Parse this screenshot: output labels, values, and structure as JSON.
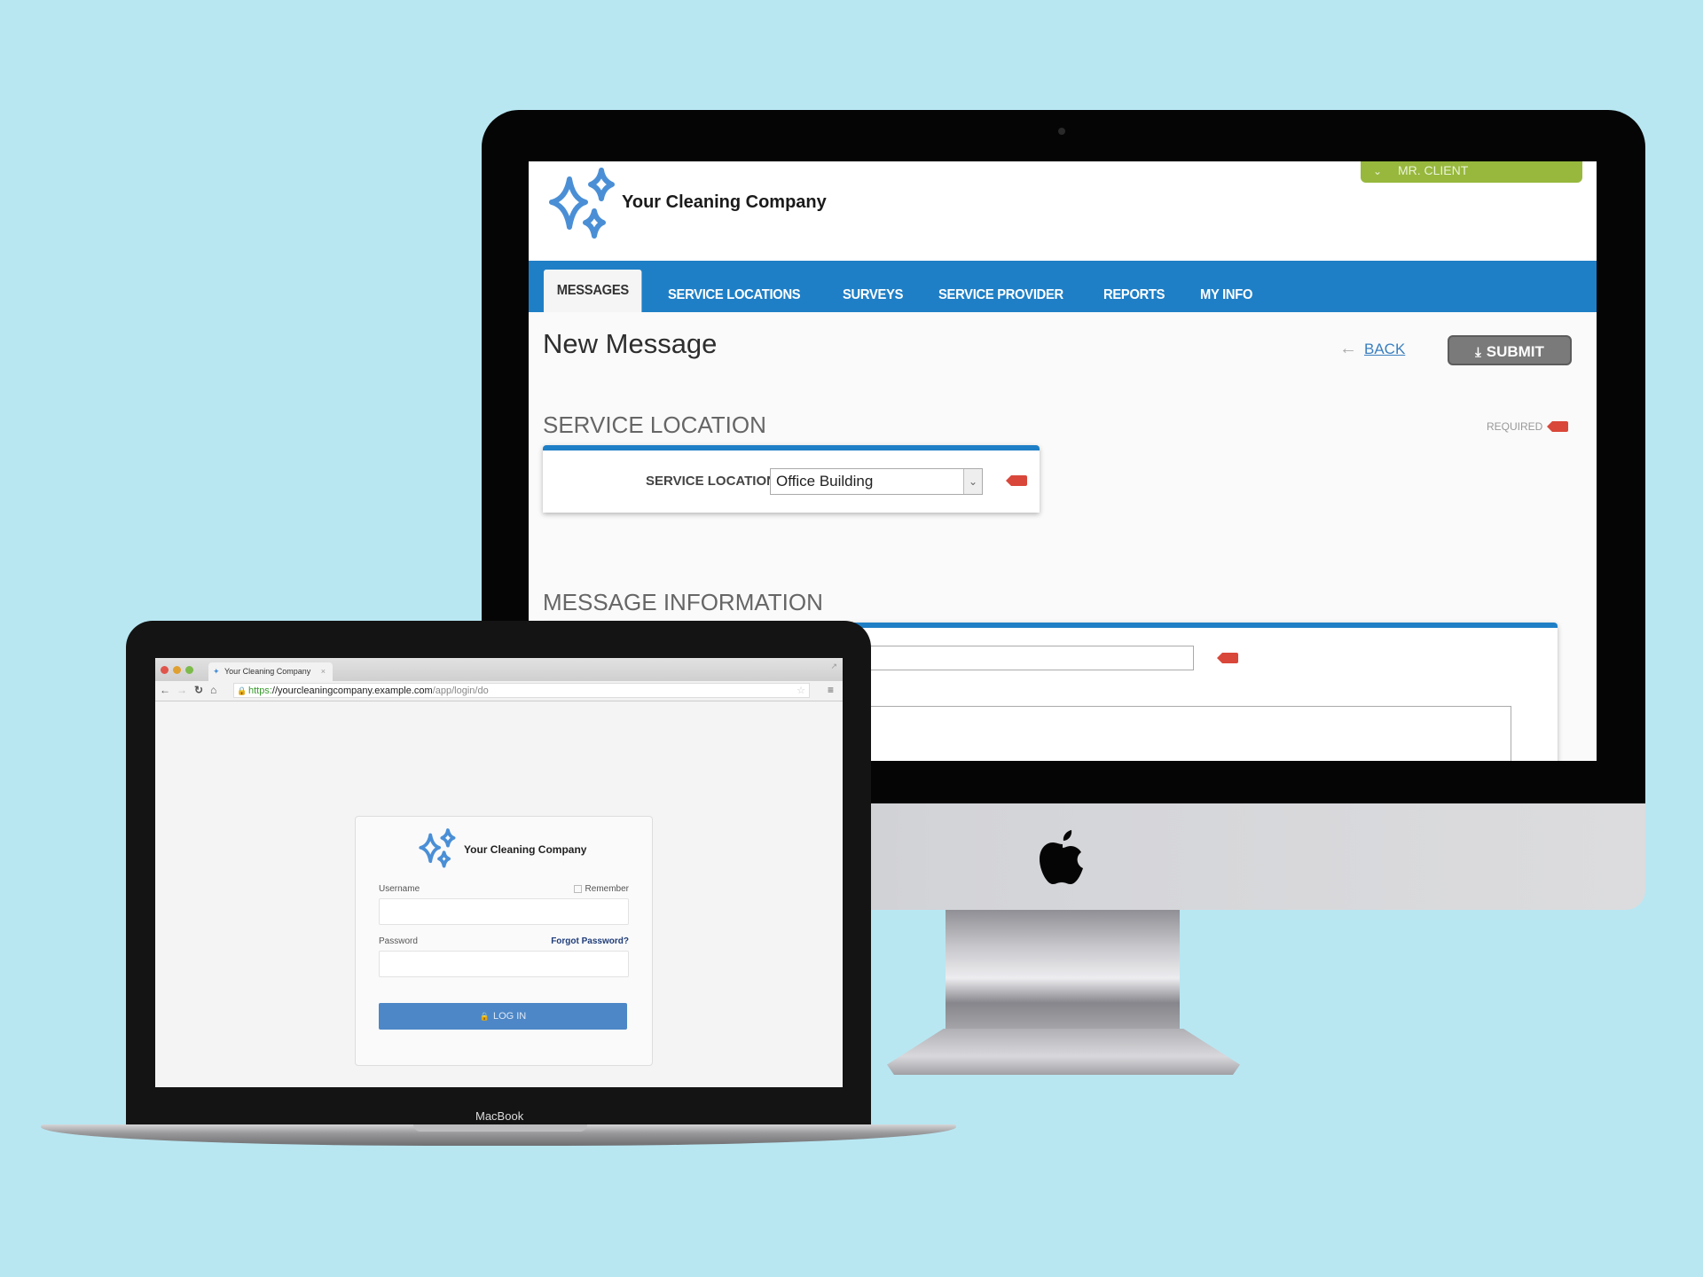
{
  "imac_app": {
    "brand": "Your Cleaning Company",
    "user_menu": {
      "label": "MR. CLIENT",
      "icon": "chevron-down-icon",
      "color": "#97b83d"
    },
    "nav": {
      "color": "#1f7fc6",
      "tabs": [
        {
          "label": "MESSAGES",
          "active": true
        },
        {
          "label": "SERVICE LOCATIONS",
          "active": false
        },
        {
          "label": "SURVEYS",
          "active": false
        },
        {
          "label": "SERVICE PROVIDER",
          "active": false
        },
        {
          "label": "REPORTS",
          "active": false
        },
        {
          "label": "MY INFO",
          "active": false
        }
      ]
    },
    "page_title": "New Message",
    "back_label": "BACK",
    "submit_label": "SUBMIT",
    "required_label": "REQUIRED",
    "required_color": "#d9473a",
    "service_location_section": {
      "title": "SERVICE LOCATION",
      "field_label": "SERVICE LOCATION",
      "selected_value": "Office Building"
    },
    "message_information_section": {
      "title": "MESSAGE INFORMATION",
      "subject_value": "",
      "body_value": ""
    }
  },
  "macbook_browser": {
    "tab_title": "Your Cleaning Company",
    "url": {
      "scheme": "https:",
      "host": "//yourcleaningcompany.example.com",
      "path": "/app/login/do"
    },
    "login": {
      "brand": "Your Cleaning Company",
      "username_label": "Username",
      "username_value": "",
      "remember_label": "Remember",
      "remember_checked": false,
      "password_label": "Password",
      "password_value": "",
      "forgot_label": "Forgot Password?",
      "login_button": "LOG IN",
      "button_color": "#4d87c7"
    },
    "device_label": "MacBook"
  }
}
